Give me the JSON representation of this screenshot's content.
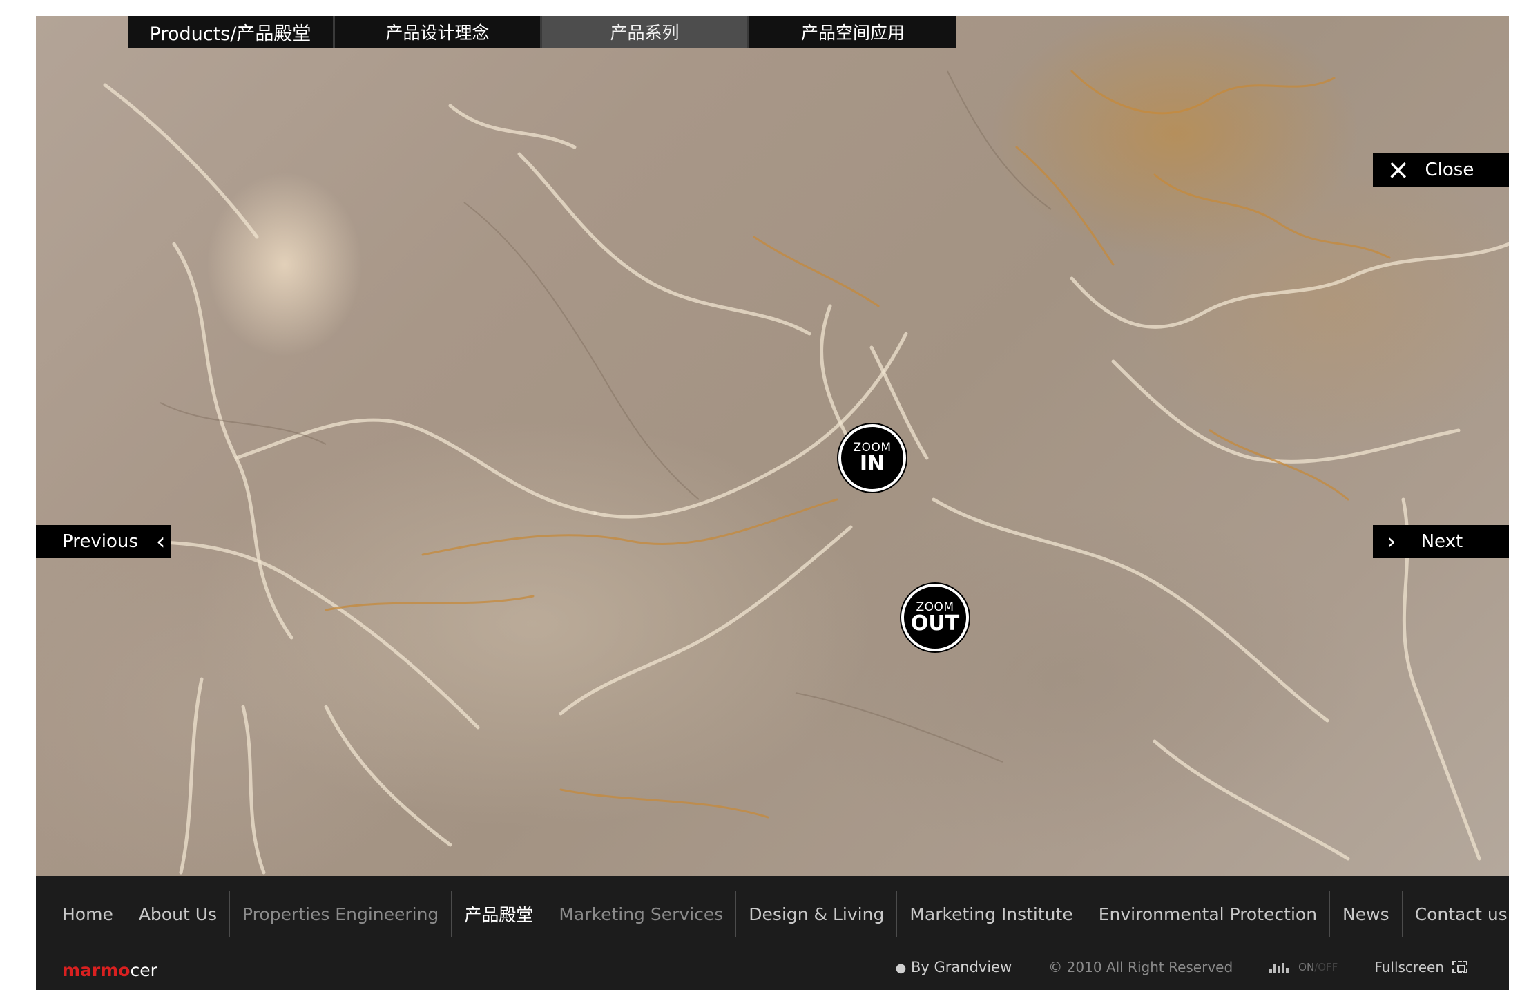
{
  "tabs": {
    "products": "Products/产品殿堂",
    "design_concept": "产品设计理念",
    "series": "产品系列",
    "space_application": "产品空间应用"
  },
  "controls": {
    "close_label": "Close",
    "previous_label": "Previous",
    "next_label": "Next",
    "zoom_in_top": "ZOOM",
    "zoom_in_bottom": "IN",
    "zoom_out_top": "ZOOM",
    "zoom_out_bottom": "OUT",
    "close_icon": "×",
    "prev_icon": "‹",
    "next_icon": "›"
  },
  "footer_nav": {
    "items": [
      {
        "label": "Home"
      },
      {
        "label": "About Us"
      },
      {
        "label": "Properties Engineering"
      },
      {
        "label": "产品殿堂"
      },
      {
        "label": "Marketing Services"
      },
      {
        "label": "Design & Living"
      },
      {
        "label": "Marketing Institute"
      },
      {
        "label": "Environmental Protection"
      },
      {
        "label": "News"
      },
      {
        "label": "Contact us"
      }
    ]
  },
  "footer_bottom": {
    "brand_red": "marmo",
    "brand_white": "cer",
    "by": "By Grandview",
    "copyright": "© 2010 All Right Reserved",
    "on": "ON",
    "off": "/OFF",
    "fullscreen": "Fullscreen"
  },
  "colors": {
    "panel": "#000000",
    "footer_bg": "#1c1c1c",
    "active_tab": "#4d4d4d",
    "brand_red": "#d92020"
  }
}
